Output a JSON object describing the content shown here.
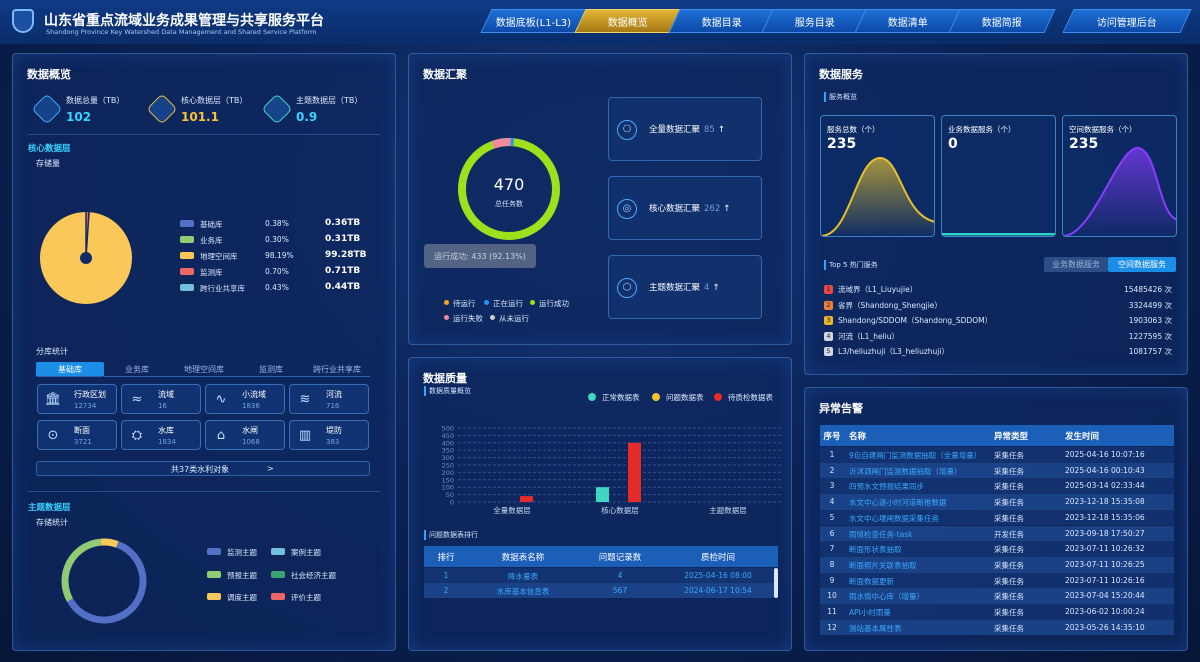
{
  "header": {
    "title": "山东省重点流域业务成果管理与共享服务平台",
    "subtitle": "Shandong Province Key Watershed Data Management and Shared Service Platform"
  },
  "nav": [
    "数据底板(L1-L3)",
    "数据概览",
    "数据目录",
    "服务目录",
    "数据清单",
    "数据简报",
    "访问管理后台"
  ],
  "overview": {
    "title": "数据概览",
    "kpis": [
      {
        "label": "数据总量（TB）",
        "value": "102"
      },
      {
        "label": "核心数据层（TB）",
        "value": "101.1"
      },
      {
        "label": "主题数据层（TB）",
        "value": "0.9"
      }
    ],
    "core_title": "核心数据层",
    "storage_label": "存储量",
    "storage": [
      {
        "name": "基础库",
        "pct": "0.38%",
        "size": "0.36TB",
        "color": "#5470c6"
      },
      {
        "name": "业务库",
        "pct": "0.30%",
        "size": "0.31TB",
        "color": "#91cc75"
      },
      {
        "name": "地理空间库",
        "pct": "98.19%",
        "size": "99.28TB",
        "color": "#fac858"
      },
      {
        "name": "监测库",
        "pct": "0.70%",
        "size": "0.71TB",
        "color": "#ee6666"
      },
      {
        "name": "跨行业共享库",
        "pct": "0.43%",
        "size": "0.44TB",
        "color": "#73c0de"
      }
    ],
    "branch_title": "分库统计",
    "tabs": [
      "基础库",
      "业务库",
      "地理空间库",
      "监测库",
      "跨行业共享库"
    ],
    "cells": [
      {
        "icon": "🏛",
        "name": "行政区划",
        "value": "12734"
      },
      {
        "icon": "≈",
        "name": "流域",
        "value": "16"
      },
      {
        "icon": "∿",
        "name": "小流域",
        "value": "1836"
      },
      {
        "icon": "≋",
        "name": "河流",
        "value": "716"
      },
      {
        "icon": "⊙",
        "name": "断面",
        "value": "3721"
      },
      {
        "icon": "⛭",
        "name": "水库",
        "value": "1834"
      },
      {
        "icon": "⌂",
        "name": "水闸",
        "value": "1068"
      },
      {
        "icon": "▥",
        "name": "堤防",
        "value": "383"
      }
    ],
    "more": "共37类水利对象",
    "more_arrow": ">",
    "theme_title": "主题数据层",
    "theme_storage": "存储统计",
    "themes": [
      {
        "name": "监测主题",
        "color": "#5470c6"
      },
      {
        "name": "案例主题",
        "color": "#73c0de"
      },
      {
        "name": "预报主题",
        "color": "#91cc75"
      },
      {
        "name": "社会经济主题",
        "color": "#3ba272"
      },
      {
        "name": "调度主题",
        "color": "#fac858"
      },
      {
        "name": "评价主题",
        "color": "#ee6666"
      }
    ]
  },
  "aggregation": {
    "title": "数据汇聚",
    "total": "470",
    "total_label": "总任务数",
    "tooltip": "运行成功: 433 (92.13%)",
    "legend": [
      {
        "name": "待运行",
        "color": "#f5a623"
      },
      {
        "name": "正在运行",
        "color": "#2196f3"
      },
      {
        "name": "运行成功",
        "color": "#9ee01b"
      },
      {
        "name": "运行失败",
        "color": "#f08a9c"
      },
      {
        "name": "从未运行",
        "color": "#d0d0d0"
      }
    ],
    "items": [
      {
        "label": "全量数据汇聚",
        "count": "85",
        "icon": "⎔"
      },
      {
        "label": "核心数据汇聚",
        "count": "262",
        "icon": "◎"
      },
      {
        "label": "主题数据汇聚",
        "count": "4",
        "icon": "⬡"
      }
    ],
    "arrow": "↑"
  },
  "quality": {
    "title": "数据质量",
    "overview": "数据质量概览",
    "chart_data": {
      "type": "bar",
      "categories": [
        "全量数据层",
        "核心数据层",
        "主题数据层"
      ],
      "series": [
        {
          "name": "正常数据表",
          "color": "#3fd6c2",
          "values": [
            0,
            100,
            0
          ]
        },
        {
          "name": "问题数据表",
          "color": "#f2c12e",
          "values": [
            0,
            0,
            0
          ]
        },
        {
          "name": "待质检数据表",
          "color": "#e52a2a",
          "values": [
            40,
            400,
            0
          ]
        }
      ],
      "ylim": [
        0,
        500
      ],
      "yticks": [
        "0",
        "50",
        "100",
        "150",
        "200",
        "250",
        "300",
        "350",
        "400",
        "450",
        "500"
      ]
    },
    "rank_title": "问题数据表排行",
    "columns": [
      "排行",
      "数据表名称",
      "问题记录数",
      "质检时间"
    ],
    "rows": [
      [
        "1",
        "降水量表",
        "4",
        "2025-04-16 08:00"
      ],
      [
        "2",
        "水库基本信息表",
        "567",
        "2024-06-17 10:54"
      ]
    ]
  },
  "service": {
    "title": "数据服务",
    "overview": "服务概览",
    "cards": [
      {
        "label": "服务总数（个）",
        "value": "235",
        "color": "#e6c02c"
      },
      {
        "label": "业务数据服务（个）",
        "value": "0",
        "color": "#2ed3c6"
      },
      {
        "label": "空间数据服务（个）",
        "value": "235",
        "color": "#8a3cff"
      }
    ],
    "top_title": "Top 5 热门服务",
    "tabs": [
      "业务数据服务",
      "空间数据服务"
    ],
    "top": [
      {
        "rank": "1",
        "name": "流域界（L1_Liuyujie）",
        "count": "15485426 次",
        "color": "#e84545"
      },
      {
        "rank": "2",
        "name": "省界（Shandong_Shengjie）",
        "count": "3324499 次",
        "color": "#ef7d3b"
      },
      {
        "rank": "3",
        "name": "Shandong/SDDOM（Shandong_SDDOM）",
        "count": "1903063 次",
        "color": "#e8b62c"
      },
      {
        "rank": "4",
        "name": "河流（L1_heliu）",
        "count": "1227595 次",
        "color": "#d0d6e0"
      },
      {
        "rank": "5",
        "name": "L3/heliuzhuji（L3_heliuzhuji）",
        "count": "1081757 次",
        "color": "#d0d6e0"
      }
    ]
  },
  "alarm": {
    "title": "异常告警",
    "columns": [
      "序号",
      "名称",
      "异常类型",
      "发生时间"
    ],
    "rows": [
      [
        "1",
        "9包自建闸门监测数据抽取（全量增量）",
        "采集任务",
        "2025-04-16 10:07:16"
      ],
      [
        "2",
        "沂沭泗闸门监测数据抽取（增量）",
        "采集任务",
        "2025-04-16 00:10:43"
      ],
      [
        "3",
        "四预水文预报结果同步",
        "采集任务",
        "2025-03-14 02:33:44"
      ],
      [
        "4",
        "水文中心逐小时河道断推数据",
        "采集任务",
        "2023-12-18 15:35:08"
      ],
      [
        "5",
        "水文中心堰闸数据采集任务",
        "采集任务",
        "2023-12-18 15:35:06"
      ],
      [
        "6",
        "雨情检查任务-task",
        "开发任务",
        "2023-09-18 17:50:27"
      ],
      [
        "7",
        "断面形状表抽取",
        "采集任务",
        "2023-07-11 10:26:32"
      ],
      [
        "8",
        "断面照片关联表抽取",
        "采集任务",
        "2023-07-11 10:26:25"
      ],
      [
        "9",
        "断面数据更新",
        "采集任务",
        "2023-07-11 10:26:16"
      ],
      [
        "10",
        "雨水情中心库（增量）",
        "采集任务",
        "2023-07-04 15:20:44"
      ],
      [
        "11",
        "API小时雨量",
        "采集任务",
        "2023-06-02 10:00:24"
      ],
      [
        "12",
        "测站基本属性表",
        "采集任务",
        "2023-05-26 14:35:10"
      ]
    ]
  }
}
